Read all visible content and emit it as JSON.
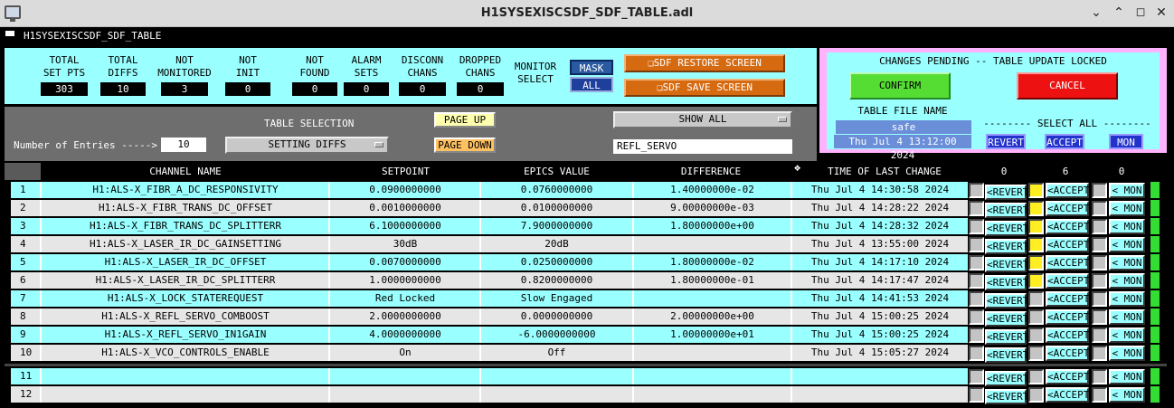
{
  "window": {
    "title": "H1SYSEXISCSDF_SDF_TABLE.adl",
    "app_label": "H1SYSEXISCSDF_SDF_TABLE"
  },
  "stats": [
    {
      "label1": "TOTAL",
      "label2": "SET PTS",
      "value": "303"
    },
    {
      "label1": "TOTAL",
      "label2": "DIFFS",
      "value": "10"
    },
    {
      "label1": "NOT",
      "label2": "MONITORED",
      "value": "3"
    },
    {
      "label1": "NOT",
      "label2": "INIT",
      "value": "0"
    },
    {
      "label1": "NOT",
      "label2": "FOUND",
      "value": "0"
    },
    {
      "label1": "ALARM",
      "label2": "SETS",
      "value": "0"
    },
    {
      "label1": "DISCONN",
      "label2": "CHANS",
      "value": "0"
    },
    {
      "label1": "DROPPED",
      "label2": "CHANS",
      "value": "0"
    }
  ],
  "monitor": {
    "label1": "MONITOR",
    "label2": "SELECT",
    "mask": "MASK",
    "all": "ALL"
  },
  "screens": {
    "restore": "SDF RESTORE SCREEN",
    "save": "SDF SAVE SCREEN"
  },
  "pending": {
    "title": "CHANGES PENDING -- TABLE UPDATE LOCKED",
    "confirm": "CONFIRM",
    "cancel": "CANCEL",
    "file_label": "TABLE FILE NAME",
    "file_name": "safe",
    "file_time": "Thu Jul  4 13:12:00 2024",
    "select_all": "-------- SELECT ALL --------",
    "revert": "REVERT",
    "accept": "ACCEPT",
    "mon": "MON"
  },
  "controls": {
    "table_selection_label": "TABLE SELECTION",
    "entries_label": "Number of Entries ----->",
    "entries_value": "10",
    "table_selection": "SETTING DIFFS",
    "page_up": "PAGE UP",
    "page_down": "PAGE DOWN",
    "show": "SHOW ALL",
    "filter": "REFL_SERVO"
  },
  "table": {
    "headers": {
      "channel": "CHANNEL NAME",
      "setpoint": "SETPOINT",
      "epics": "EPICS VALUE",
      "diff": "DIFFERENCE",
      "time": "TIME OF LAST CHANGE",
      "count_revert": "0",
      "count_accept": "6",
      "count_mon": "0"
    },
    "button_labels": {
      "revert": "<REVERT",
      "accept": "<ACCEPT",
      "mon": "< MON"
    },
    "rows": [
      {
        "n": "1",
        "channel": "H1:ALS-X_FIBR_A_DC_RESPONSIVITY",
        "setpoint": "0.0900000000",
        "epics": "0.0760000000",
        "diff": "1.40000000e-02",
        "time": "Thu Jul  4 14:30:58 2024",
        "accept": true
      },
      {
        "n": "2",
        "channel": "H1:ALS-X_FIBR_TRANS_DC_OFFSET",
        "setpoint": "0.0010000000",
        "epics": "0.0100000000",
        "diff": "9.00000000e-03",
        "time": "Thu Jul  4 14:28:22 2024",
        "accept": true
      },
      {
        "n": "3",
        "channel": "H1:ALS-X_FIBR_TRANS_DC_SPLITTERR",
        "setpoint": "6.1000000000",
        "epics": "7.9000000000",
        "diff": "1.80000000e+00",
        "time": "Thu Jul  4 14:28:32 2024",
        "accept": true
      },
      {
        "n": "4",
        "channel": "H1:ALS-X_LASER_IR_DC_GAINSETTING",
        "setpoint": "30dB",
        "epics": "20dB",
        "diff": "",
        "time": "Thu Jul  4 13:55:00 2024",
        "accept": true
      },
      {
        "n": "5",
        "channel": "H1:ALS-X_LASER_IR_DC_OFFSET",
        "setpoint": "0.0070000000",
        "epics": "0.0250000000",
        "diff": "1.80000000e-02",
        "time": "Thu Jul  4 14:17:10 2024",
        "accept": true
      },
      {
        "n": "6",
        "channel": "H1:ALS-X_LASER_IR_DC_SPLITTERR",
        "setpoint": "1.0000000000",
        "epics": "0.8200000000",
        "diff": "1.80000000e-01",
        "time": "Thu Jul  4 14:17:47 2024",
        "accept": true
      },
      {
        "n": "7",
        "channel": "H1:ALS-X_LOCK_STATEREQUEST",
        "setpoint": "Red Locked",
        "epics": "Slow Engaged",
        "diff": "",
        "time": "Thu Jul  4 14:41:53 2024",
        "accept": false
      },
      {
        "n": "8",
        "channel": "H1:ALS-X_REFL_SERVO_COMBOOST",
        "setpoint": "2.0000000000",
        "epics": "0.0000000000",
        "diff": "2.00000000e+00",
        "time": "Thu Jul  4 15:00:25 2024",
        "accept": false
      },
      {
        "n": "9",
        "channel": "H1:ALS-X_REFL_SERVO_IN1GAIN",
        "setpoint": "4.0000000000",
        "epics": "-6.0000000000",
        "diff": "1.00000000e+01",
        "time": "Thu Jul  4 15:00:25 2024",
        "accept": false
      },
      {
        "n": "10",
        "channel": "H1:ALS-X_VCO_CONTROLS_ENABLE",
        "setpoint": "On",
        "epics": "Off",
        "diff": "",
        "time": "Thu Jul  4 15:05:27 2024",
        "accept": false
      },
      {
        "n": "11",
        "channel": "",
        "setpoint": "",
        "epics": "",
        "diff": "",
        "time": "",
        "accept": false
      },
      {
        "n": "12",
        "channel": "",
        "setpoint": "",
        "epics": "",
        "diff": "",
        "time": "",
        "accept": false
      }
    ]
  }
}
